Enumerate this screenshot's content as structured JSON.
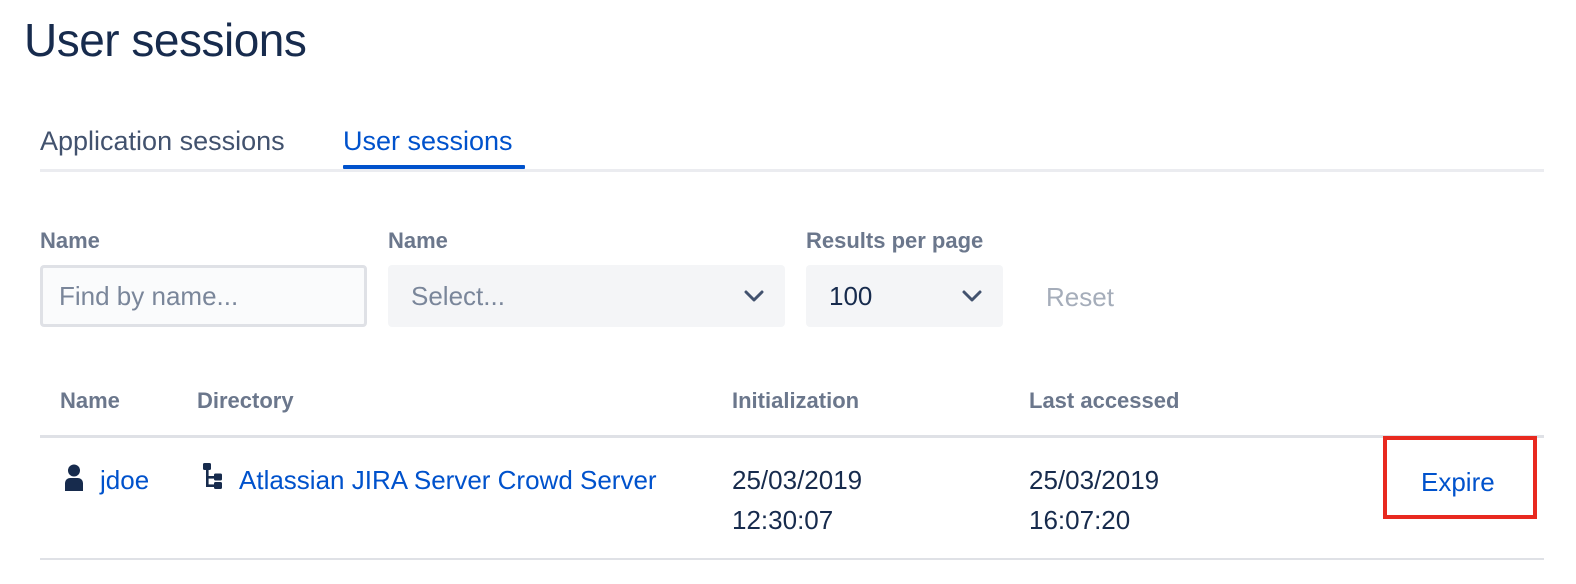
{
  "page": {
    "title": "User sessions"
  },
  "tabs": [
    {
      "label": "Application sessions",
      "active": false
    },
    {
      "label": "User sessions",
      "active": true
    }
  ],
  "filters": {
    "name_input": {
      "label": "Name",
      "placeholder": "Find by name...",
      "value": ""
    },
    "directory_select": {
      "label": "Name",
      "placeholder": "Select..."
    },
    "results_select": {
      "label": "Results per page",
      "value": "100"
    },
    "reset_label": "Reset"
  },
  "table": {
    "headers": {
      "name": "Name",
      "directory": "Directory",
      "initialization": "Initialization",
      "last_accessed": "Last accessed"
    },
    "rows": [
      {
        "name": "jdoe",
        "directory": "Atlassian JIRA Server Crowd Server",
        "initialization_date": "25/03/2019",
        "initialization_time": "12:30:07",
        "last_accessed_date": "25/03/2019",
        "last_accessed_time": "16:07:20",
        "action": "Expire"
      }
    ]
  },
  "icons": {
    "user": "user-icon",
    "directory": "directory-tree-icon",
    "chevron": "chevron-down-icon"
  },
  "colors": {
    "link": "#0052cc",
    "text": "#172b4d",
    "muted": "#6b778c",
    "highlight": "#e8291f"
  }
}
